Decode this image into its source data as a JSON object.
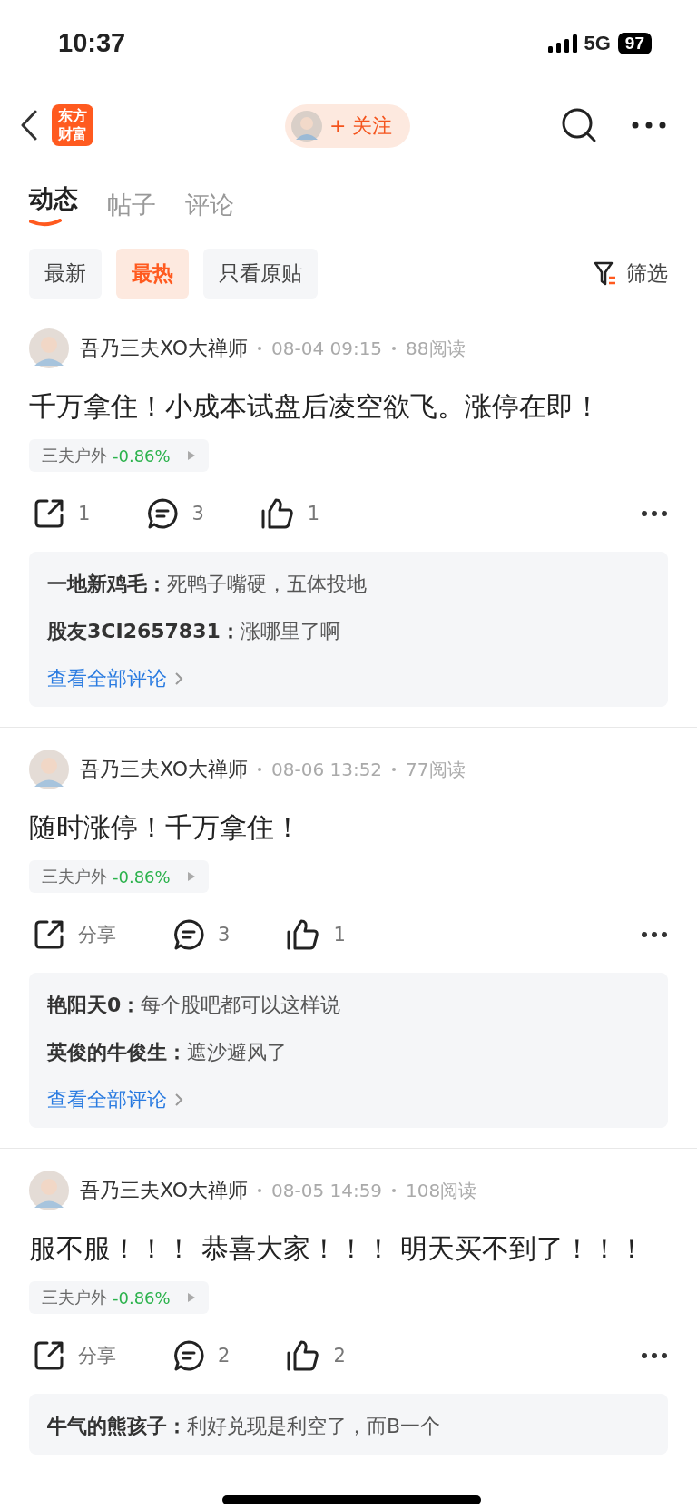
{
  "status_bar": {
    "time": "10:37",
    "network": "5G",
    "battery": "97"
  },
  "header": {
    "logo": "东方财富",
    "follow_button": "+ 关注"
  },
  "tabs": [
    {
      "label": "动态",
      "selected": true
    },
    {
      "label": "帖子",
      "selected": false
    },
    {
      "label": "评论",
      "selected": false
    }
  ],
  "filters": [
    {
      "label": "最新",
      "selected": false
    },
    {
      "label": "最热",
      "selected": true
    },
    {
      "label": "只看原贴",
      "selected": false
    }
  ],
  "filter_button": "筛选",
  "posts": [
    {
      "author": "吾乃三夫XO大禅师",
      "time": "08-04 09:15",
      "reads": "88阅读",
      "text": "千万拿住！小成本试盘后凌空欲飞。涨停在即！",
      "stock": {
        "name": "三夫户外",
        "change": "-0.86%"
      },
      "share": "1",
      "comments": "3",
      "likes": "1",
      "replies": [
        {
          "user": "一地新鸡毛：",
          "text": "死鸭子嘴硬，五体投地"
        },
        {
          "user": "股友3CI2657831：",
          "text": "涨哪里了啊"
        }
      ],
      "view_all": "查看全部评论"
    },
    {
      "author": "吾乃三夫XO大禅师",
      "time": "08-06 13:52",
      "reads": "77阅读",
      "text": "随时涨停！千万拿住！",
      "stock": {
        "name": "三夫户外",
        "change": "-0.86%"
      },
      "share": "分享",
      "comments": "3",
      "likes": "1",
      "replies": [
        {
          "user": "艳阳天0：",
          "text": "每个股吧都可以这样说"
        },
        {
          "user": "英俊的牛俊生：",
          "text": "遮沙避风了"
        }
      ],
      "view_all": "查看全部评论"
    },
    {
      "author": "吾乃三夫XO大禅师",
      "time": "08-05 14:59",
      "reads": "108阅读",
      "text": "服不服！！！ 恭喜大家！！！ 明天买不到了！！！",
      "stock": {
        "name": "三夫户外",
        "change": "-0.86%"
      },
      "share": "分享",
      "comments": "2",
      "likes": "2",
      "replies": [
        {
          "user": "牛气的熊孩子：",
          "text": "利好兑现是利空了，而B一个"
        }
      ]
    }
  ]
}
